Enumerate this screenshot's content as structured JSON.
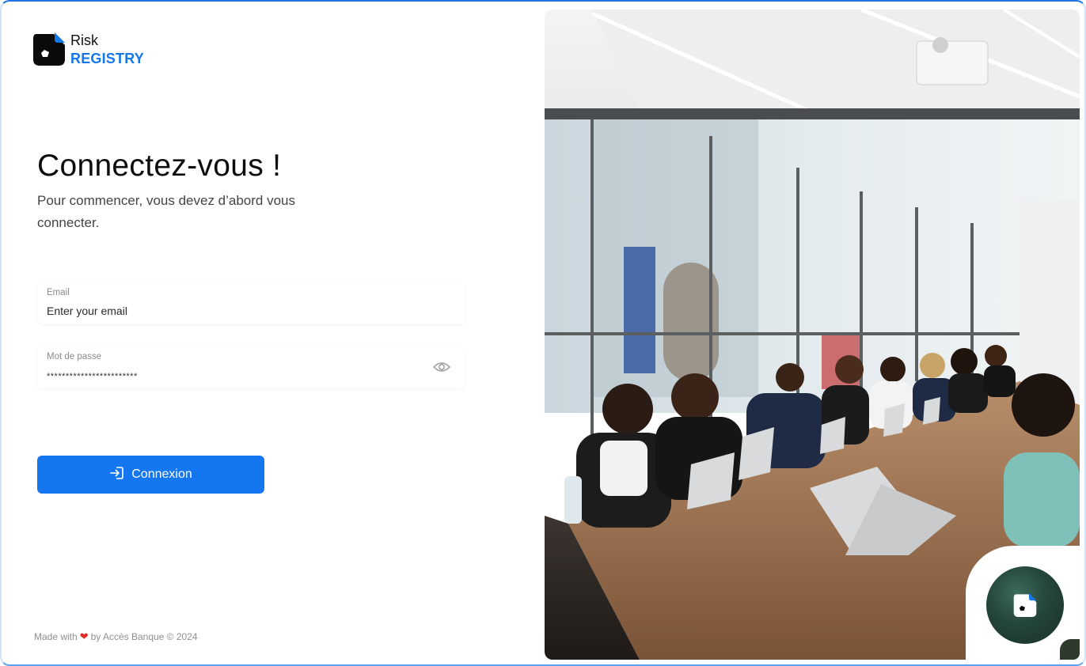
{
  "brand": {
    "line1": "Risk",
    "line2": "REGISTRY",
    "accent_color": "#1577e9",
    "icon": "risk-registry-logo-icon"
  },
  "login": {
    "title": "Connectez-vous !",
    "subtitle": "Pour commencer, vous devez d’abord vous connecter.",
    "email": {
      "label": "Email",
      "placeholder": "Enter your email",
      "value": ""
    },
    "password": {
      "label": "Mot de passe",
      "value": "************************",
      "toggle_icon": "eye-icon"
    },
    "submit": {
      "label": "Connexion",
      "icon": "login-icon",
      "color": "#1577ef"
    }
  },
  "footer": {
    "made_with": "Made with",
    "by": "by Accès Banque © 2024",
    "heart_icon": "heart-icon"
  },
  "hero": {
    "image": "meeting-room-photo",
    "badge_icon": "risk-registry-logo-icon"
  }
}
